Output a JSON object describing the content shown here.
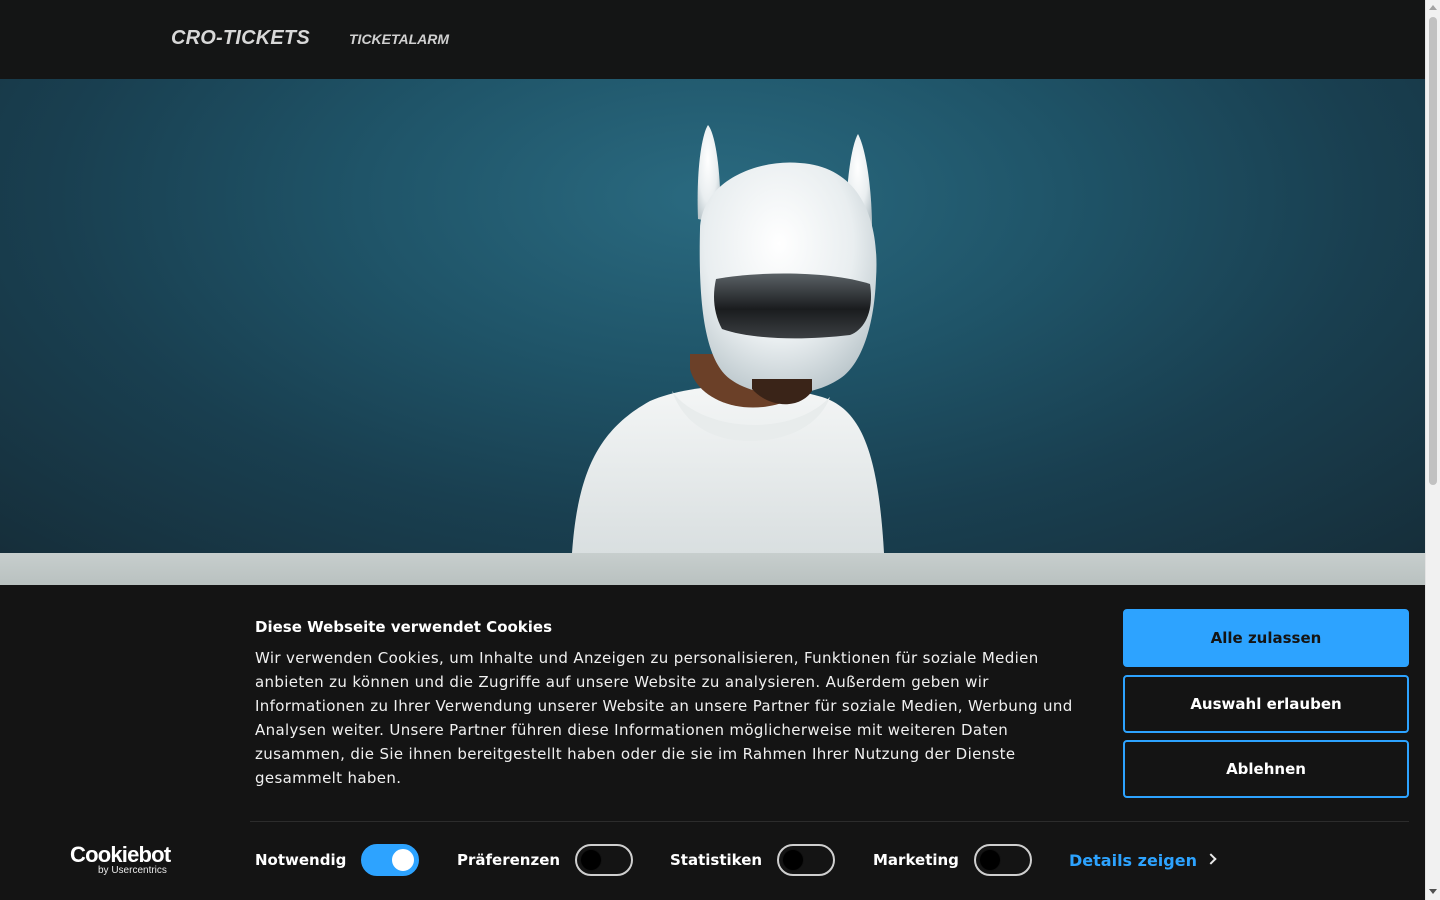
{
  "nav": {
    "brand": "CRO-TICKETS",
    "links": [
      {
        "label": "TICKETALARM"
      }
    ]
  },
  "hero": {
    "image_desc": "person-in-white-helmet-icon"
  },
  "cookie_banner": {
    "title": "Diese Webseite verwendet Cookies",
    "text": "Wir verwenden Cookies, um Inhalte und Anzeigen zu personalisieren, Funktionen für soziale Medien anbieten zu können und die Zugriffe auf unsere Website zu analysieren. Außerdem geben wir Informationen zu Ihrer Verwendung unserer Website an unsere Partner für soziale Medien, Werbung und Analysen weiter. Unsere Partner führen diese Informationen möglicherweise mit weiteren Daten zusammen, die Sie ihnen bereitgestellt haben oder die sie im Rahmen Ihrer Nutzung der Dienste gesammelt haben.",
    "buttons": {
      "allow_all": "Alle zulassen",
      "allow_selection": "Auswahl erlauben",
      "deny": "Ablehnen"
    },
    "toggles": [
      {
        "label": "Notwendig",
        "checked": true
      },
      {
        "label": "Präferenzen",
        "checked": false
      },
      {
        "label": "Statistiken",
        "checked": false
      },
      {
        "label": "Marketing",
        "checked": false
      }
    ],
    "details_label": "Details zeigen",
    "logo": {
      "main": "Cookiebot",
      "sub": "by Usercentrics"
    },
    "colors": {
      "accent": "#2da3ff",
      "background": "#141414"
    }
  }
}
